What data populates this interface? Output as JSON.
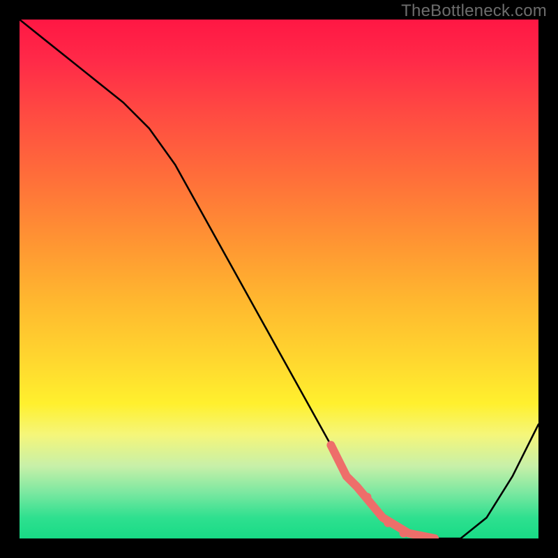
{
  "watermark": "TheBottleneck.com",
  "colors": {
    "curve": "#000000",
    "highlight": "#ee6e6a",
    "background_top": "#ff1744",
    "background_bottom": "#18db86"
  },
  "chart_data": {
    "type": "line",
    "title": "",
    "xlabel": "",
    "ylabel": "",
    "xlim": [
      0,
      100
    ],
    "ylim": [
      0,
      100
    ],
    "series": [
      {
        "name": "bottleneck-curve",
        "x": [
          0,
          5,
          10,
          15,
          20,
          25,
          30,
          35,
          40,
          45,
          50,
          55,
          60,
          63,
          65,
          70,
          75,
          80,
          85,
          90,
          95,
          100
        ],
        "y": [
          100,
          96,
          92,
          88,
          84,
          79,
          72,
          63,
          54,
          45,
          36,
          27,
          18,
          12,
          10,
          4,
          1,
          0,
          0,
          4,
          12,
          22
        ]
      }
    ],
    "highlight_segment": {
      "description": "thick coral region near trough",
      "x": [
        60,
        63,
        65,
        70,
        75,
        80
      ],
      "y": [
        18,
        12,
        10,
        4,
        1,
        0
      ]
    },
    "highlight_dots": {
      "x": [
        67,
        71,
        74,
        77
      ],
      "y": [
        8,
        3,
        1,
        0
      ]
    }
  }
}
